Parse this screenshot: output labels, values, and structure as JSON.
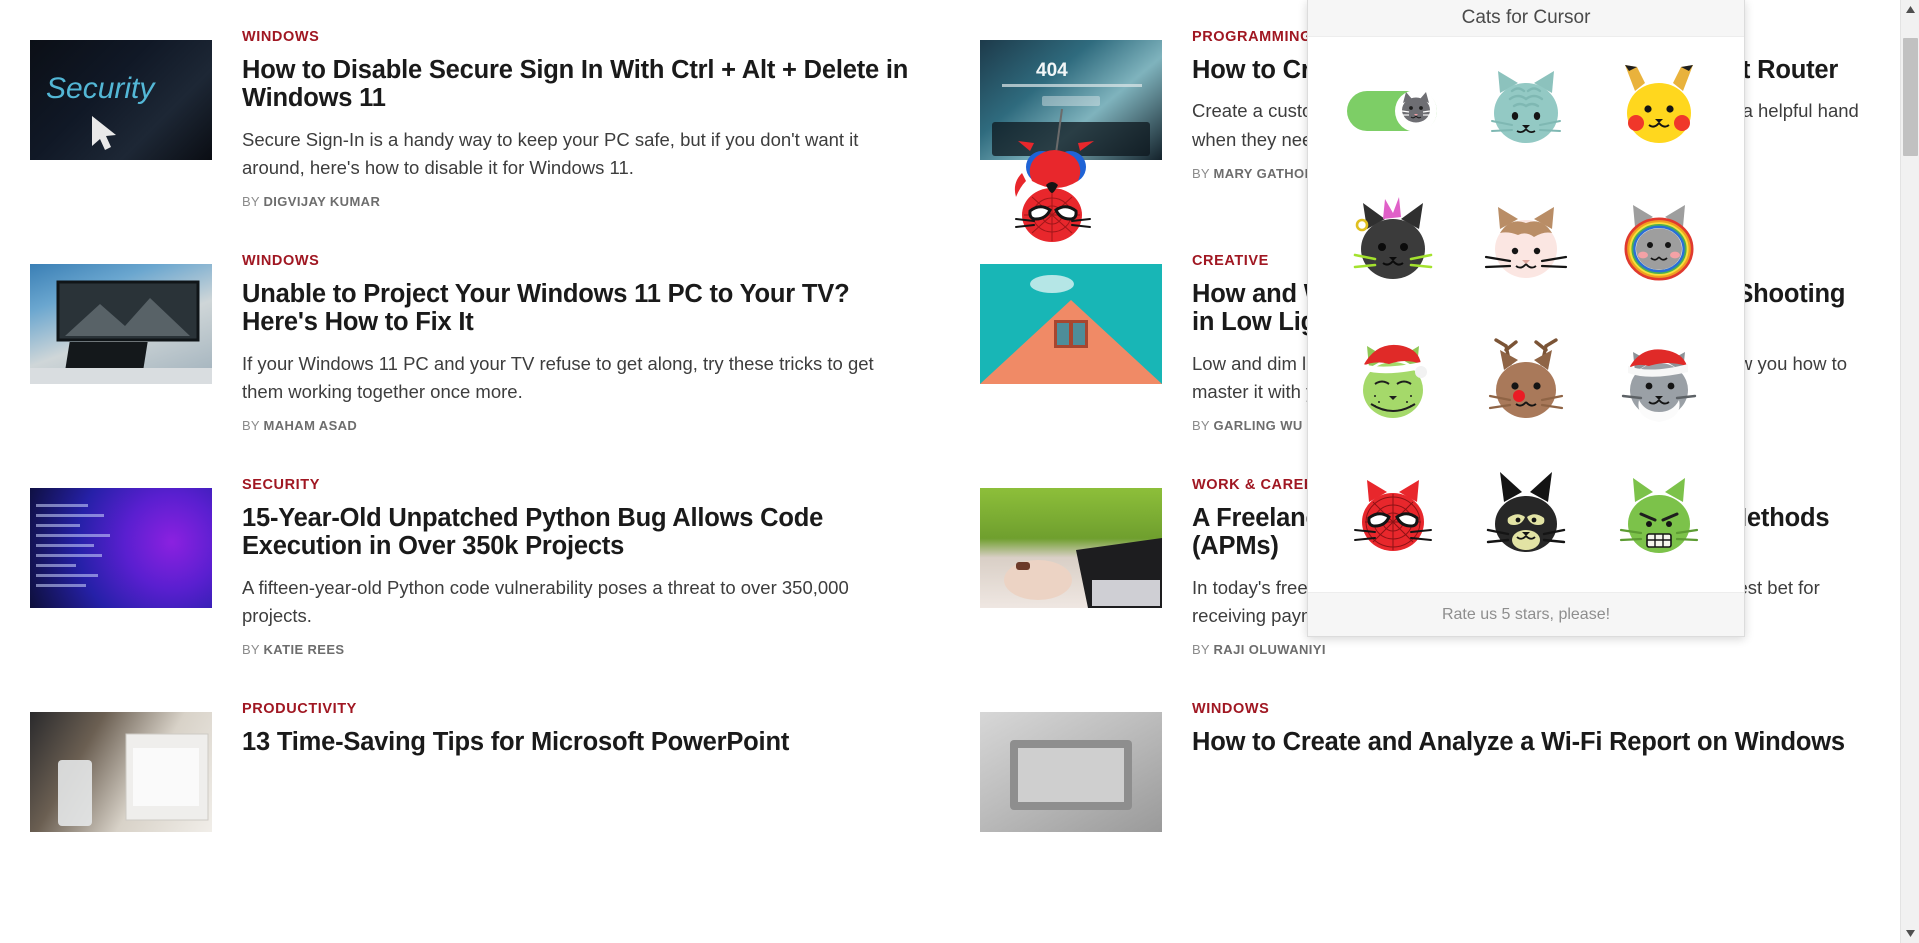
{
  "popup": {
    "title": "Cats for Cursor",
    "footer_text": "Rate us 5 stars, please!",
    "toggle": {
      "state": "on",
      "track_color": "#7dce66",
      "knob_color": "#ffffff"
    },
    "cats": [
      {
        "name": "toggle-switch-cat",
        "label": "Enable cursor toggle",
        "color": "#7dce66"
      },
      {
        "name": "tabby-blue-cat",
        "label": "Blue Tabby Cat",
        "color": "#93c9c4"
      },
      {
        "name": "pikachu-cat",
        "label": "Pikachu Cat",
        "color": "#ffd71e"
      },
      {
        "name": "punk-black-cat",
        "label": "Punk Black Cat",
        "color": "#3b3b3b"
      },
      {
        "name": "cream-tabby-cat",
        "label": "Cream Tabby Cat",
        "color": "#fbe6e2"
      },
      {
        "name": "rainbow-grey-cat",
        "label": "Rainbow Grey Cat",
        "color": "#9e9e9e"
      },
      {
        "name": "grinch-cat",
        "label": "Grinch Cat",
        "color": "#a5d96a"
      },
      {
        "name": "reindeer-cat",
        "label": "Reindeer Cat",
        "color": "#a9795a"
      },
      {
        "name": "santa-cat",
        "label": "Santa Cat",
        "color": "#9aa0a6"
      },
      {
        "name": "spiderman-cat",
        "label": "Spider-Man Cat",
        "color": "#e8272c"
      },
      {
        "name": "batman-cat",
        "label": "Batman Cat",
        "color": "#272727"
      },
      {
        "name": "hulk-cat",
        "label": "Hulk Cat",
        "color": "#7cc24a"
      }
    ]
  },
  "scrollbar": {
    "up_arrow": "▲",
    "down_arrow": "▼",
    "thumb_position_percent": 6
  },
  "cursor": {
    "name": "spiderman-cat-cursor"
  },
  "columns": [
    {
      "name": "left-column",
      "articles": [
        {
          "category": "WINDOWS",
          "headline": "How to Disable Secure Sign In With Ctrl + Alt + Delete in Windows 11",
          "dek": "Secure Sign-In is a handy way to keep your PC safe, but if you don't want it around, here's how to disable it for Windows 11.",
          "by_label": "BY",
          "author": "DIGVIJAY KUMAR",
          "thumb_alt": "security-keyboard-thumbnail"
        },
        {
          "category": "WINDOWS",
          "headline": "Unable to Project Your Windows 11 PC to Your TV? Here's How to Fix It",
          "dek": "If your Windows 11 PC and your TV refuse to get along, try these tricks to get them working together once more.",
          "by_label": "BY",
          "author": "MAHAM ASAD",
          "thumb_alt": "tv-monitor-desk-thumbnail"
        },
        {
          "category": "SECURITY",
          "headline": "15-Year-Old Unpatched Python Bug Allows Code Execution in Over 350k Projects",
          "dek": "A fifteen-year-old Python code vulnerability poses a threat to over 350,000 projects.",
          "by_label": "BY",
          "author": "KATIE REES",
          "thumb_alt": "purple-code-thumbnail"
        },
        {
          "category": "PRODUCTIVITY",
          "headline": "13 Time-Saving Tips for Microsoft PowerPoint",
          "dek": "",
          "by_label": "",
          "author": "",
          "thumb_alt": "laptop-desk-jar-thumbnail"
        }
      ]
    },
    {
      "name": "right-column",
      "articles": [
        {
          "category": "PROGRAMMING",
          "headline": "How to Create a Custom 404 Page Using React Router",
          "dek": "Create a custom page for your app's 404 route to give your visitors a helpful hand when they need it most.",
          "by_label": "BY",
          "author": "MARY GATHONI",
          "thumb_alt": "laptop-404-thumbnail"
        },
        {
          "category": "CREATIVE",
          "headline": "How and What Camera Settings to Use When Shooting in Low Light",
          "dek": "Low and dim light can be tricky to work with, and this guide will show you how to master it with your camera.",
          "by_label": "BY",
          "author": "GARLING WU",
          "thumb_alt": "orange-house-window-thumbnail"
        },
        {
          "category": "WORK & CAREER",
          "headline": "A Freelancer's Guide to Alternative Payment Methods (APMs)",
          "dek": "In today's freelance world, alternative payment methods are your best bet for receiving payments from your clients. Here'…",
          "by_label": "BY",
          "author": "RAJI OLUWANIYI",
          "thumb_alt": "hands-laptop-plants-thumbnail"
        },
        {
          "category": "WINDOWS",
          "headline": "How to Create and Analyze a Wi-Fi Report on Windows",
          "dek": "",
          "by_label": "",
          "author": "",
          "thumb_alt": "grey-laptop-thumbnail"
        }
      ]
    }
  ],
  "colors": {
    "category_red": "#a01722",
    "headline": "#1a1a1a",
    "body_text": "#3d3d3d",
    "byline": "#8b8b8b",
    "popup_chrome": "#f6f6f6",
    "scrollbar_thumb": "#c1c1c1"
  }
}
